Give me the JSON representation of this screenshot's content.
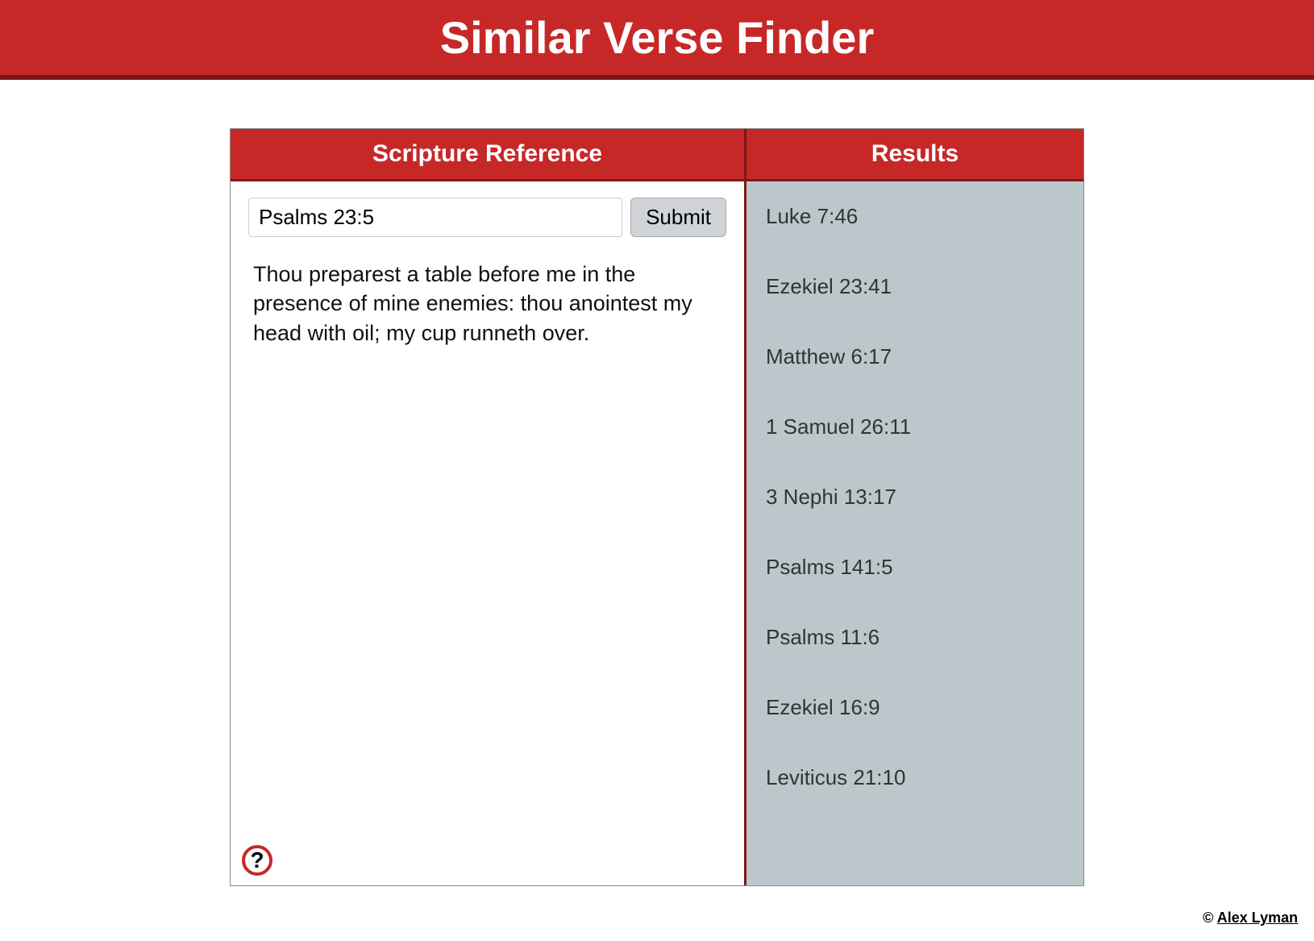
{
  "header": {
    "title": "Similar Verse Finder"
  },
  "left": {
    "header": "Scripture Reference",
    "input_value": "Psalms 23:5",
    "submit_label": "Submit",
    "verse_text": "Thou preparest a table before me in the presence of mine enemies: thou anointest my head with oil; my cup runneth over."
  },
  "right": {
    "header": "Results",
    "items": [
      "Luke 7:46",
      "Ezekiel 23:41",
      "Matthew 6:17",
      "1 Samuel 26:11",
      "3 Nephi 13:17",
      "Psalms 141:5",
      "Psalms 11:6",
      "Ezekiel 16:9",
      "Leviticus 21:10"
    ]
  },
  "help_label": "?",
  "footer": {
    "copyright": "©",
    "author": "Alex Lyman"
  }
}
